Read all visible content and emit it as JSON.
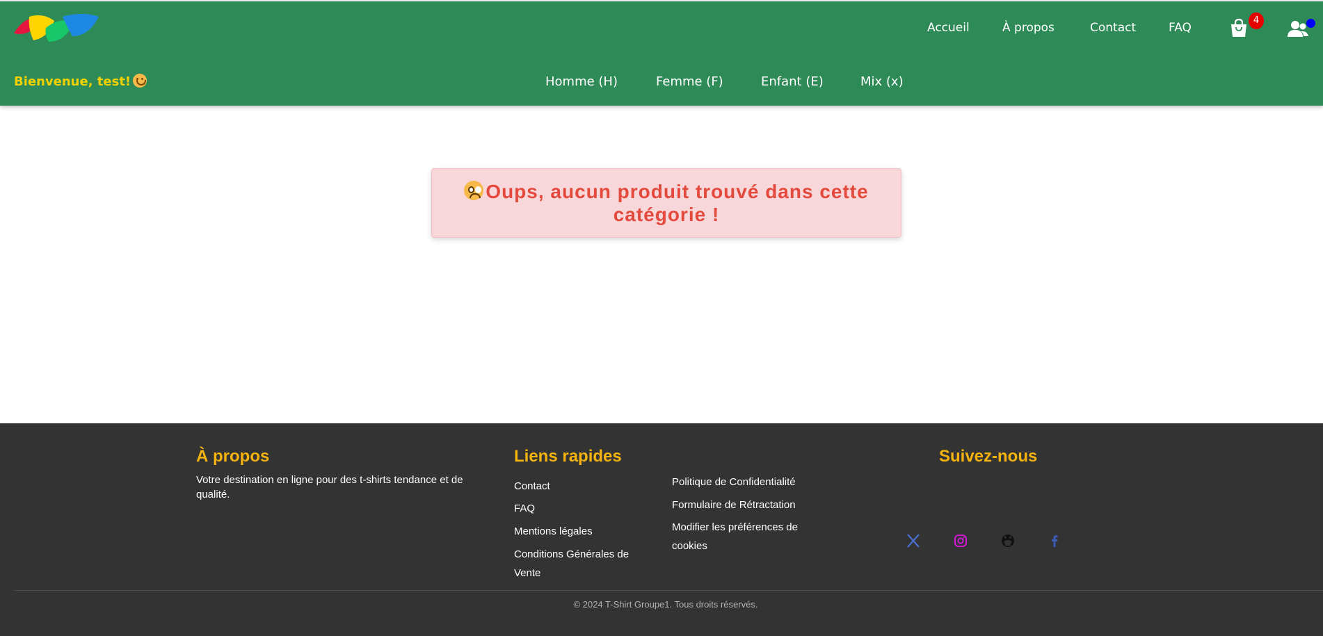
{
  "header": {
    "logo": "tshirt-groupe1-logo",
    "top_nav": {
      "home": "Accueil",
      "about": "À propos",
      "contact": "Contact",
      "faq": "FAQ"
    },
    "cart_icon": "shopping-bag-icon",
    "cart_count": "4",
    "user_icon": "users-icon",
    "user_status_color": "#0000ff",
    "welcome": "Bienvenue, test!",
    "categories": {
      "men": "Homme (H)",
      "women": "Femme (F)",
      "kids": "Enfant (E)",
      "mix": "Mix (x)"
    },
    "colors": {
      "background": "#2e8b57",
      "welcome": "#f1d000"
    }
  },
  "main": {
    "alert_message": "Oups, aucun produit trouvé dans cette catégorie !",
    "alert_icon": "sad-face-icon",
    "colors": {
      "alert_bg": "#f8d7da",
      "alert_text": "#e34a3d"
    }
  },
  "footer": {
    "about": {
      "heading": "À propos",
      "text": "Votre destination en ligne pour des t-shirts tendance et de qualité."
    },
    "quick_links": {
      "heading": "Liens rapides",
      "col1": {
        "contact": "Contact",
        "faq": "FAQ",
        "legal": "Mentions légales",
        "cgv": "Conditions Générales de Vente"
      },
      "col2": {
        "privacy": "Politique de Confidentialité",
        "withdrawal": "Formulaire de Rétractation",
        "cookies": "Modifier les préférences de cookies"
      }
    },
    "follow": {
      "heading": "Suivez-nous",
      "icons": [
        "x-twitter-icon",
        "instagram-icon",
        "github-icon",
        "facebook-icon"
      ]
    },
    "copyright": "© 2024 T-Shirt Groupe1. Tous droits réservés.",
    "colors": {
      "background": "#333333",
      "heading": "#f4b30e"
    }
  }
}
